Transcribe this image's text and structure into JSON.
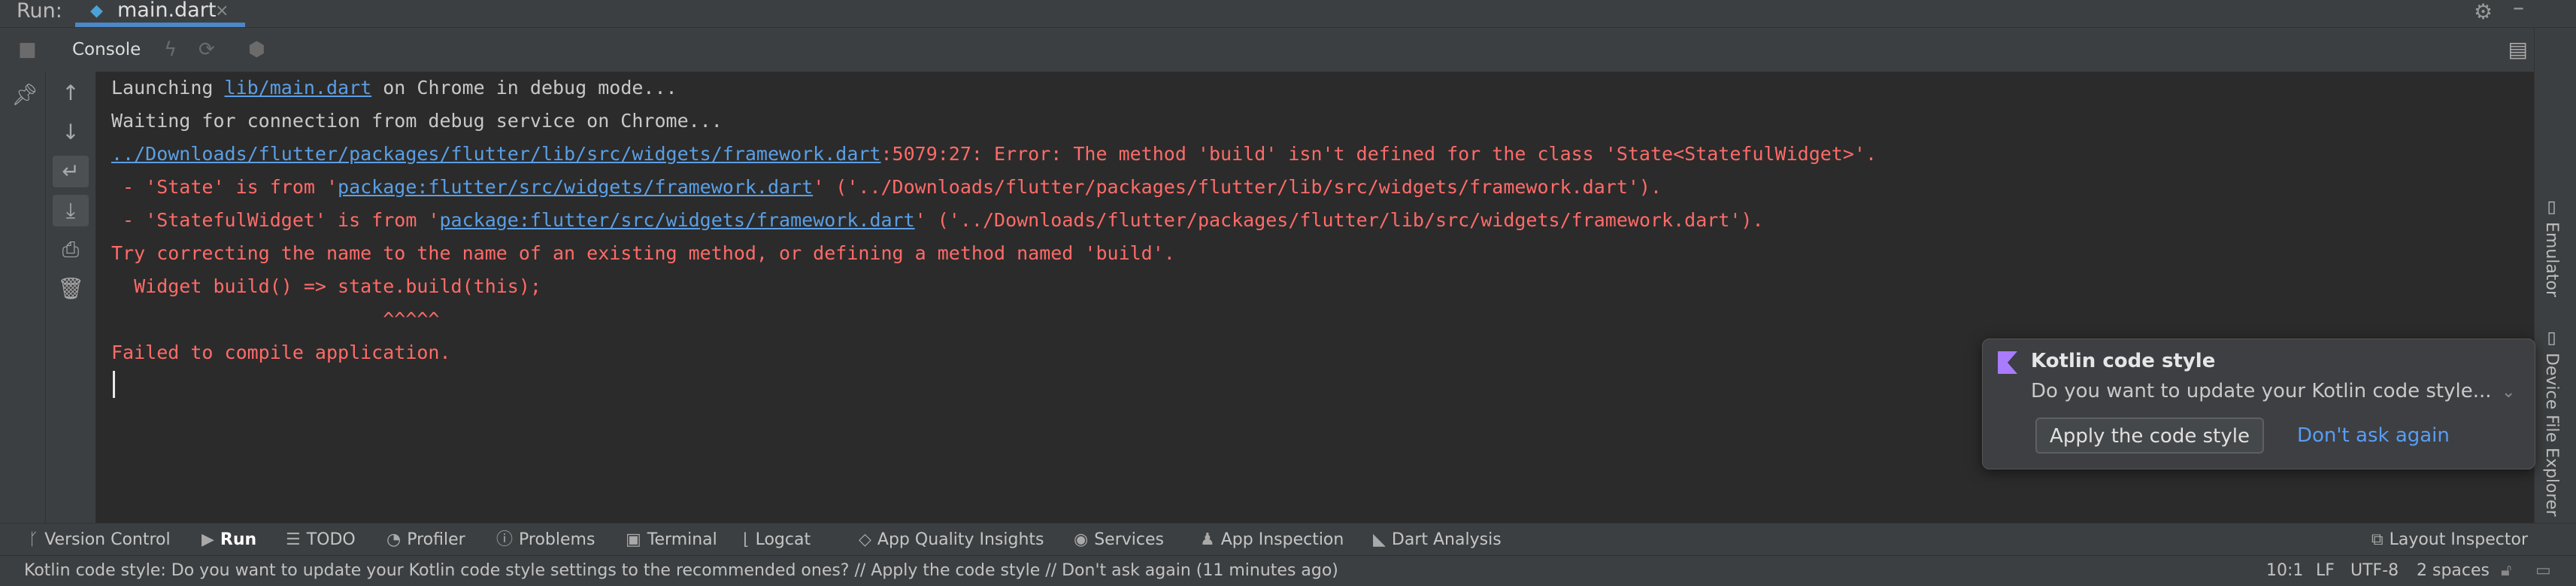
{
  "run_header": {
    "label": "Run:",
    "tab_label": "main.dart",
    "tab_icon": "dart-icon",
    "close_glyph": "×"
  },
  "console_toolbar": {
    "tab_label": "Console"
  },
  "console": {
    "lines": [
      {
        "segments": [
          {
            "text": "Launching ",
            "style": "plain"
          },
          {
            "text": "lib/main.dart",
            "style": "link"
          },
          {
            "text": " on Chrome in debug mode...",
            "style": "plain"
          }
        ]
      },
      {
        "segments": [
          {
            "text": "Waiting for connection from debug service on Chrome...",
            "style": "plain"
          }
        ]
      },
      {
        "segments": [
          {
            "text": "../Downloads/flutter/packages/flutter/lib/src/widgets/framework.dart",
            "style": "link"
          },
          {
            "text": ":5079:27: Error: The method 'build' isn't defined for the class 'State<StatefulWidget>'.",
            "style": "error"
          }
        ]
      },
      {
        "segments": [
          {
            "text": " - 'State' is from '",
            "style": "error"
          },
          {
            "text": "package:flutter/src/widgets/framework.dart",
            "style": "link"
          },
          {
            "text": "' ('../Downloads/flutter/packages/flutter/lib/src/widgets/framework.dart').",
            "style": "error"
          }
        ]
      },
      {
        "segments": [
          {
            "text": " - 'StatefulWidget' is from '",
            "style": "error"
          },
          {
            "text": "package:flutter/src/widgets/framework.dart",
            "style": "link"
          },
          {
            "text": "' ('../Downloads/flutter/packages/flutter/lib/src/widgets/framework.dart').",
            "style": "error"
          }
        ]
      },
      {
        "segments": [
          {
            "text": "Try correcting the name to the name of an existing method, or defining a method named 'build'.",
            "style": "error"
          }
        ]
      },
      {
        "segments": [
          {
            "text": "  Widget build() => state.build(this);",
            "style": "error"
          }
        ]
      },
      {
        "segments": [
          {
            "text": "                        ^^^^^",
            "style": "error"
          }
        ]
      },
      {
        "segments": [
          {
            "text": "Failed to compile application.",
            "style": "error"
          }
        ]
      }
    ]
  },
  "right_strip": {
    "emulator_label": "Emulator",
    "device_file_explorer_label": "Device File Explorer"
  },
  "notification": {
    "title": "Kotlin code style",
    "body": "Do you want to update your Kotlin code style...",
    "apply_label": "Apply the code style",
    "dont_ask_label": "Don't ask again",
    "icon": "kotlin-icon",
    "icon_color": "#a97bff"
  },
  "bottom_tools": [
    {
      "label": "Version Control",
      "icon": "branch-icon",
      "glyph": "ᚴ"
    },
    {
      "label": "Run",
      "icon": "play-icon",
      "glyph": "▶",
      "active": true
    },
    {
      "label": "TODO",
      "icon": "list-icon",
      "glyph": "☰"
    },
    {
      "label": "Profiler",
      "icon": "gauge-icon",
      "glyph": "◔"
    },
    {
      "label": "Problems",
      "icon": "info-circle-icon",
      "glyph": "ⓘ"
    },
    {
      "label": "Terminal",
      "icon": "terminal-icon",
      "glyph": "▣"
    },
    {
      "label": "Logcat",
      "icon": "logcat-icon",
      "glyph": "⌊"
    },
    {
      "label": "App Quality Insights",
      "icon": "diamond-icon",
      "glyph": "◇"
    },
    {
      "label": "Services",
      "icon": "services-icon",
      "glyph": "◉"
    },
    {
      "label": "App Inspection",
      "icon": "inspection-icon",
      "glyph": "♟"
    },
    {
      "label": "Dart Analysis",
      "icon": "dart-analysis-icon",
      "glyph": "◣"
    }
  ],
  "layout_inspector": {
    "label": "Layout Inspector",
    "icon": "layout-inspector-icon"
  },
  "status_bar": {
    "message": "Kotlin code style: Do you want to update your Kotlin code style settings to the recommended ones? // Apply the code style // Don't ask again (11 minutes ago)",
    "position": "10:1",
    "line_sep": "LF",
    "encoding": "UTF-8",
    "indent": "2 spaces"
  },
  "colors": {
    "error": "#ff6b68",
    "link": "#5a9fe6",
    "accent": "#4a88c7"
  }
}
